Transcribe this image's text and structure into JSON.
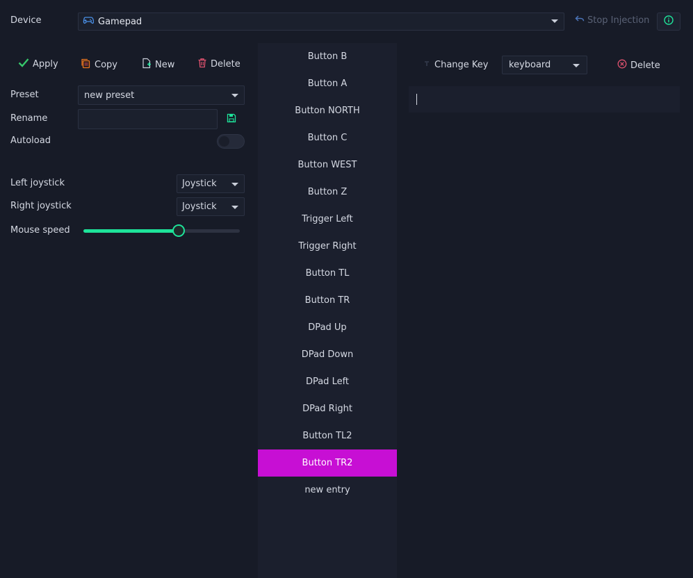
{
  "header": {
    "device_label": "Device",
    "device_value": "Gamepad",
    "stop_label": "Stop Injection"
  },
  "toolbar": {
    "apply": "Apply",
    "copy": "Copy",
    "new": "New",
    "delete": "Delete"
  },
  "form": {
    "preset_label": "Preset",
    "preset_value": "new preset",
    "rename_label": "Rename",
    "rename_value": "",
    "autoload_label": "Autoload",
    "autoload_on": false,
    "left_joystick_label": "Left joystick",
    "left_joystick_value": "Joystick",
    "right_joystick_label": "Right joystick",
    "right_joystick_value": "Joystick",
    "mouse_speed_label": "Mouse speed",
    "mouse_speed_fraction": 0.61
  },
  "mappings": {
    "items": [
      "Button B",
      "Button A",
      "Button NORTH",
      "Button C",
      "Button WEST",
      "Button Z",
      "Trigger Left",
      "Trigger Right",
      "Button TL",
      "Button TR",
      "DPad Up",
      "DPad Down",
      "DPad Left",
      "DPad Right",
      "Button TL2",
      "Button TR2",
      "new entry"
    ],
    "selected_index": 15
  },
  "editor": {
    "change_key_label": "Change Key",
    "target_value": "keyboard",
    "delete_label": "Delete",
    "code": ""
  },
  "colors": {
    "accent": "#1ee39a",
    "selected": "#c70fd4",
    "danger": "#e0526f",
    "background": "#171b27"
  },
  "icons": {
    "device": "gamepad-icon",
    "stop": "undo-icon",
    "info": "info-icon",
    "apply": "check-icon",
    "copy": "copy-icon",
    "new": "new-file-icon",
    "delete": "trash-icon",
    "save": "save-icon",
    "change_key": "record-icon",
    "delete_mapping": "close-circle-icon"
  }
}
